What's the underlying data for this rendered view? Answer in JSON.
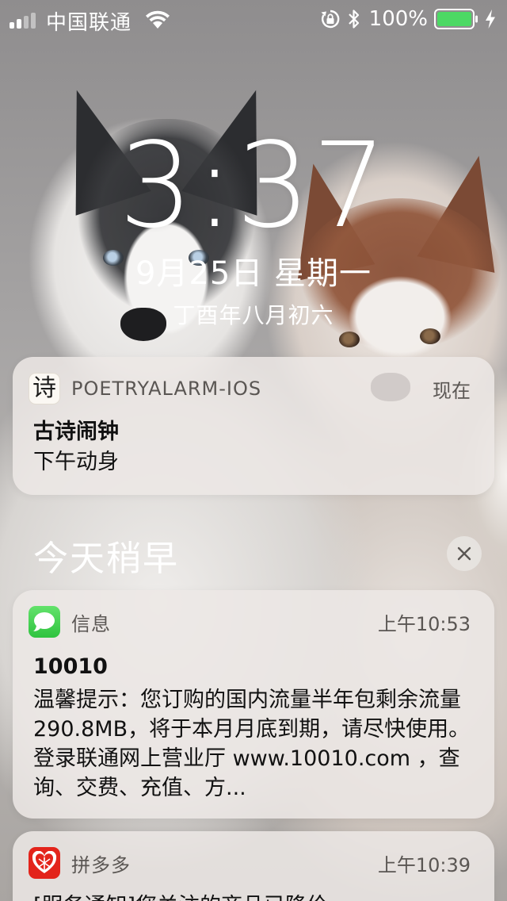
{
  "status_bar": {
    "carrier": "中国联通",
    "battery_percent": "100%",
    "signal_bars": 4,
    "signal_bars_filled": 2,
    "icons": [
      "signal-icon",
      "wifi-icon",
      "orientation-lock-icon",
      "bluetooth-icon",
      "battery-icon",
      "charging-bolt-icon"
    ],
    "battery_color": "#4cd964"
  },
  "lockscreen": {
    "time": "3:37",
    "date": "9月25日 星期一",
    "lunar_date": "丁酉年八月初六"
  },
  "notifications": [
    {
      "app_name": "POETRYALARM-IOS",
      "time": "现在",
      "icon": "poetry-app-icon",
      "icon_glyph": "诗",
      "title": "古诗闹钟",
      "body": "下午动身"
    }
  ],
  "earlier": {
    "header": "今天稍早",
    "clear_icon": "close-icon",
    "notifications": [
      {
        "app_name": "信息",
        "time": "上午10:53",
        "icon": "messages-icon",
        "icon_color": "#34c84a",
        "title": "10010",
        "body": "温馨提示：您订购的国内流量半年包剩余流量290.8MB，将于本月月底到期，请尽快使用。登录联通网上营业厅 www.10010.com ，查询、交费、充值、方..."
      },
      {
        "app_name": "拼多多",
        "time": "上午10:39",
        "icon": "pinduoduo-icon",
        "icon_color": "#e3241b",
        "body": "[服务通知]您关注的商品已降价"
      }
    ]
  }
}
